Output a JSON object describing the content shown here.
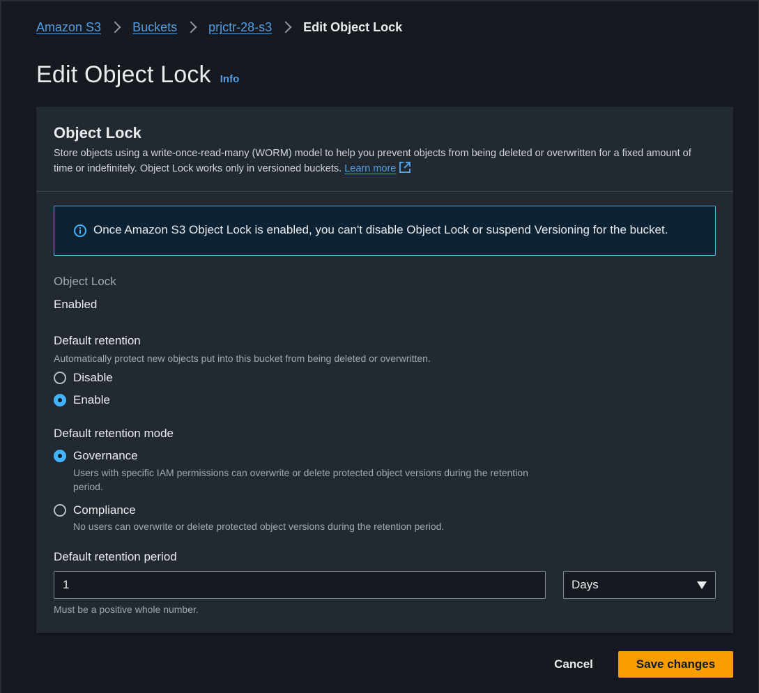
{
  "breadcrumb": {
    "items": [
      "Amazon S3",
      "Buckets",
      "prjctr-28-s3"
    ],
    "current": "Edit Object Lock"
  },
  "page": {
    "title": "Edit Object Lock",
    "info_label": "Info"
  },
  "panel": {
    "title": "Object Lock",
    "description": "Store objects using a write-once-read-many (WORM) model to help you prevent objects from being deleted or overwritten for a fixed amount of time or indefinitely. Object Lock works only in versioned buckets.",
    "learn_more": "Learn more",
    "alert_text": "Once Amazon S3 Object Lock is enabled, you can't disable Object Lock or suspend Versioning for the bucket."
  },
  "object_lock": {
    "label": "Object Lock",
    "value": "Enabled"
  },
  "default_retention": {
    "label": "Default retention",
    "description": "Automatically protect new objects put into this bucket from being deleted or overwritten.",
    "options": [
      "Disable",
      "Enable"
    ],
    "selected": "Enable"
  },
  "retention_mode": {
    "label": "Default retention mode",
    "governance_label": "Governance",
    "governance_desc": "Users with specific IAM permissions can overwrite or delete protected object versions during the retention period.",
    "compliance_label": "Compliance",
    "compliance_desc": "No users can overwrite or delete protected object versions during the retention period.",
    "selected": "Governance"
  },
  "retention_period": {
    "label": "Default retention period",
    "value": "1",
    "unit": "Days",
    "constraint": "Must be a positive whole number."
  },
  "actions": {
    "cancel_label": "Cancel",
    "save_label": "Save changes"
  },
  "colors": {
    "link": "#539fe5",
    "accent_radio": "#42b4ff",
    "primary_button": "#f89c00",
    "alert_border": "#4eb3e8"
  },
  "icons": [
    "chevron-right-icon",
    "info-circle-icon",
    "external-link-icon",
    "caret-down-icon"
  ]
}
